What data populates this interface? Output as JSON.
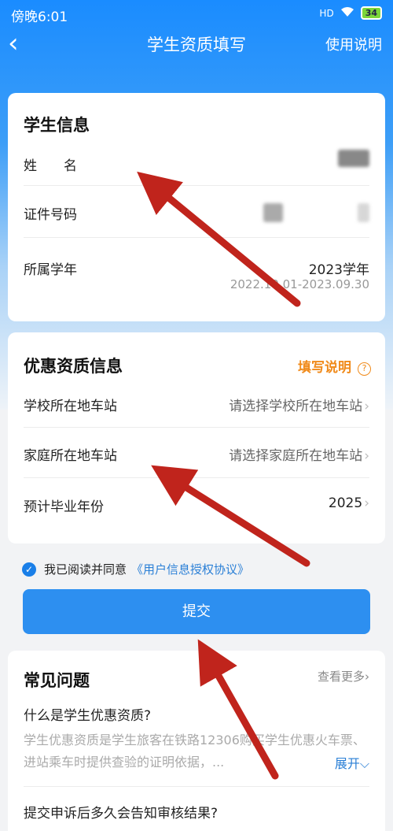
{
  "status_bar": {
    "time": "傍晚6:01",
    "network": "HD",
    "battery": "34"
  },
  "nav": {
    "title": "学生资质填写",
    "help": "使用说明",
    "back": "‹"
  },
  "student_info": {
    "title": "学生信息",
    "name_label": "姓　　名",
    "id_label": "证件号码",
    "year_label": "所属学年",
    "year_value": "2023学年",
    "year_range": "2022.10.01-2023.09.30"
  },
  "discount_info": {
    "title": "优惠资质信息",
    "fill_help": "填写说明",
    "help_symbol": "?",
    "school_station_label": "学校所在地车站",
    "school_station_placeholder": "请选择学校所在地车站",
    "home_station_label": "家庭所在地车站",
    "home_station_placeholder": "请选择家庭所在地车站",
    "grad_year_label": "预计毕业年份",
    "grad_year_value": "2025",
    "chevron": "›"
  },
  "agreement": {
    "text": "我已阅读并同意",
    "link": "《用户信息授权协议》",
    "checked": true
  },
  "submit": {
    "label": "提交"
  },
  "faq": {
    "title": "常见问题",
    "more": "查看更多›",
    "q1": "什么是学生优惠资质?",
    "a1": "学生优惠资质是学生旅客在铁路12306购买学生优惠火车票、进站乘车时提供查验的证明依据，...",
    "expand": "展开⌵",
    "q2": "提交申诉后多久会告知审核结果?"
  },
  "colors": {
    "primary": "#2d8ff0",
    "accent_orange": "#f08a1a",
    "arrow_red": "#c0241c"
  }
}
